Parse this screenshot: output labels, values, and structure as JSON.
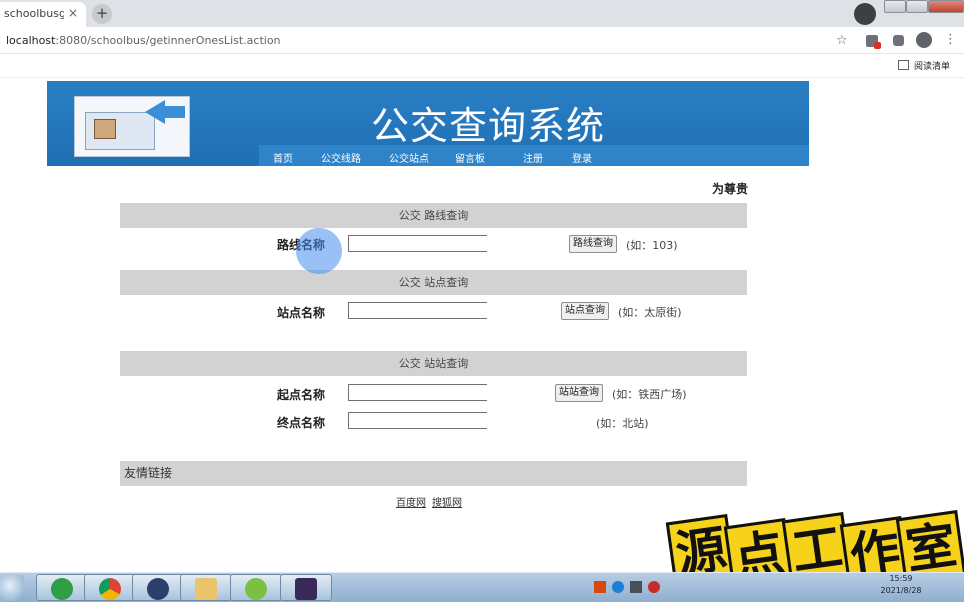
{
  "browser": {
    "tab_title": "schoolbusgetI",
    "tab_close": "×",
    "new_tab": "+",
    "url_host": "localhost",
    "url_rest": ":8080/schoolbus/getinnerOnesList.action",
    "star_icon": "☆",
    "reading_list_label": "阅读清单"
  },
  "header": {
    "title": "公交查询系统",
    "nav": [
      "首页",
      "公交线路",
      "公交站点",
      "留言板",
      "注册",
      "登录"
    ]
  },
  "welcome": "为尊贵",
  "line_query": {
    "section_title": "公交 路线查询",
    "label": "路线名称",
    "value": "",
    "button": "路线查询",
    "hint": "(如：103)"
  },
  "stop_query": {
    "section_title": "公交 站点查询",
    "label": "站点名称",
    "value": "",
    "button": "站点查询",
    "hint": "(如：太原街)"
  },
  "station_query": {
    "section_title": "公交 站站查询",
    "start_label": "起点名称",
    "start_value": "",
    "end_label": "终点名称",
    "end_value": "",
    "button": "站站查询",
    "start_hint": "(如：铁西广场)",
    "end_hint": "(如：北站)"
  },
  "friend_links": {
    "title": "友情链接",
    "links": [
      "百度网",
      "搜狐网"
    ]
  },
  "watermark": [
    "源",
    "点",
    "工",
    "作",
    "室"
  ],
  "taskbar": {
    "clock_time": "15:59",
    "clock_date": "2021/8/28"
  }
}
